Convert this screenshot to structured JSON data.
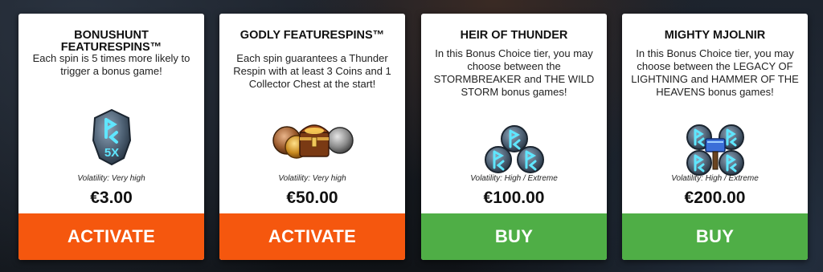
{
  "cards": [
    {
      "title": "BONUSHUNT FEATURESPINS™",
      "description": "Each spin is 5 times more likely to trigger a bonus game!",
      "volatility": "Volatility: Very high",
      "price": "€3.00",
      "button": "ACTIVATE",
      "icon": "rune-5x-icon",
      "rune_label": "5X"
    },
    {
      "title": "GODLY FEATURESPINS™",
      "description": "Each spin guarantees a Thunder Respin with at least 3 Coins and 1 Collector Chest at the start!",
      "volatility": "Volatility: Very high",
      "price": "€50.00",
      "button": "ACTIVATE",
      "icon": "treasure-chest-coins-icon"
    },
    {
      "title": "HEIR OF THUNDER",
      "description": "In this Bonus Choice tier, you may choose between the STORMBREAKER and THE WILD STORM bonus games!",
      "volatility": "Volatility: High / Extreme",
      "price": "€100.00",
      "button": "BUY",
      "icon": "three-rune-coins-icon"
    },
    {
      "title": "MIGHTY MJOLNIR",
      "description": "In this Bonus Choice tier, you may choose between the LEGACY OF LIGHTNING and HAMMER OF THE HEAVENS bonus games!",
      "volatility": "Volatility: High / Extreme",
      "price": "€200.00",
      "button": "BUY",
      "icon": "four-rune-coins-hammer-icon"
    }
  ],
  "colors": {
    "activate": "#f5570e",
    "buy": "#4fae46",
    "rune_glow": "#5fe6ff"
  }
}
